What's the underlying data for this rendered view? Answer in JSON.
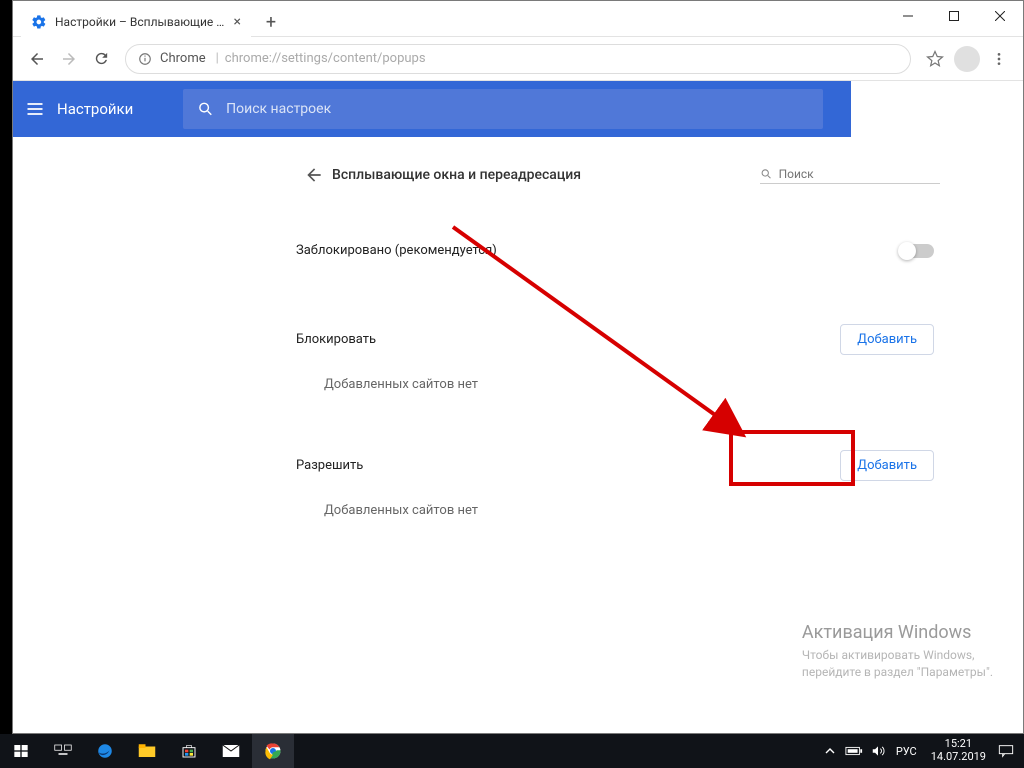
{
  "window": {
    "tab_title": "Настройки – Всплывающие окн",
    "address_origin": "Chrome",
    "address_path": "chrome://settings/content/popups"
  },
  "appbar": {
    "title": "Настройки",
    "search_placeholder": "Поиск настроек"
  },
  "panel": {
    "title": "Всплывающие окна и переадресация",
    "search_placeholder": "Поиск",
    "blocked_recommended": "Заблокировано (рекомендуется)",
    "block_heading": "Блокировать",
    "allow_heading": "Разрешить",
    "add_button": "Добавить",
    "empty_msg": "Добавленных сайтов нет"
  },
  "watermark": {
    "title": "Активация Windows",
    "line1": "Чтобы активировать Windows,",
    "line2": "перейдите в раздел \"Параметры\"."
  },
  "taskbar": {
    "lang": "РУС",
    "time": "15:21",
    "date": "14.07.2019"
  }
}
